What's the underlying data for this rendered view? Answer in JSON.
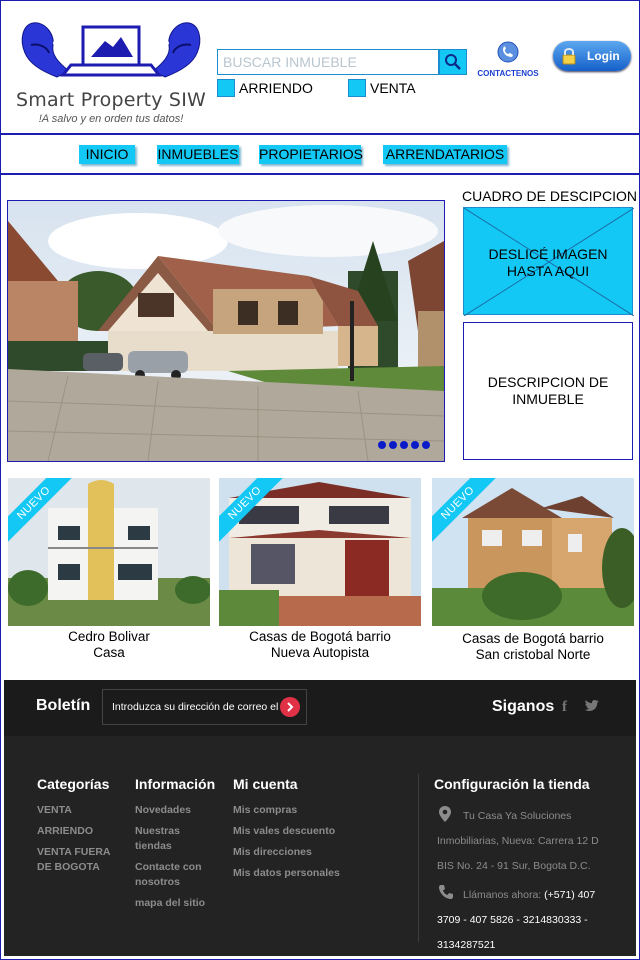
{
  "header": {
    "brand": "Smart Property SIW",
    "tagline": "!A salvo y en orden tus datos!",
    "search_placeholder": "BUSCAR INMUEBLE",
    "filter_rent": "ARRIENDO",
    "filter_sale": "VENTA",
    "contact_label": "CONTACTENOS",
    "login_label": "Login"
  },
  "nav": {
    "items": [
      "INICIO",
      "INMUEBLES",
      "PROPIETARIOS",
      "ARRENDATARIOS"
    ]
  },
  "hero": {
    "slide_count": 5
  },
  "sidebar": {
    "title": "CUADRO DE DESCIPCION",
    "placeholder_text": "DESLICÉ IMAGEN HASTA AQUI",
    "description_text": "DESCRIPCION DE INMUEBLE"
  },
  "listings": [
    {
      "badge": "NUEVO",
      "line1": "Cedro Bolivar",
      "line2": "Casa"
    },
    {
      "badge": "NUEVO",
      "line1": "Casas de Bogotá barrio",
      "line2": "Nueva Autopista"
    },
    {
      "badge": "NUEVO",
      "line1": "Casas de Bogotá barrio",
      "line2": "San cristobal Norte"
    }
  ],
  "footer": {
    "newsletter_title": "Boletín",
    "newsletter_placeholder": "Introduzca su dirección de correo el",
    "follow_title": "Siganos",
    "social": [
      "f",
      "twitter"
    ],
    "categories": {
      "title": "Categorías",
      "items": [
        "VENTA",
        "ARRIENDO",
        "VENTA FUERA DE BOGOTA"
      ]
    },
    "information": {
      "title": "Información",
      "items": [
        "Novedades",
        "Nuestras tiendas",
        "Contacte con nosotros",
        "mapa del sitio"
      ]
    },
    "account": {
      "title": "Mi cuenta",
      "items": [
        "Mis compras",
        "Mis vales descuento",
        "Mis direcciones",
        "Mis datos personales"
      ]
    },
    "store": {
      "title": "Configuración la tienda",
      "address_line1": "Tu Casa Ya Soluciones",
      "address_line2": "Inmobiliarias, Nueva: Carrera 12 D",
      "address_line3": "BIS No. 24 - 91 Sur, Bogota D.C.",
      "phone_label": "Llámanos ahora:",
      "phone_line1": "(+571) 407",
      "phone_line2": "3709 - 407 5826 - 3214830333 -",
      "phone_line3": "3134287521"
    }
  },
  "colors": {
    "accent": "#14c8f5",
    "border": "#1c1cb0",
    "footer_bg": "#232323",
    "footer_text": "#8c8c8c"
  }
}
